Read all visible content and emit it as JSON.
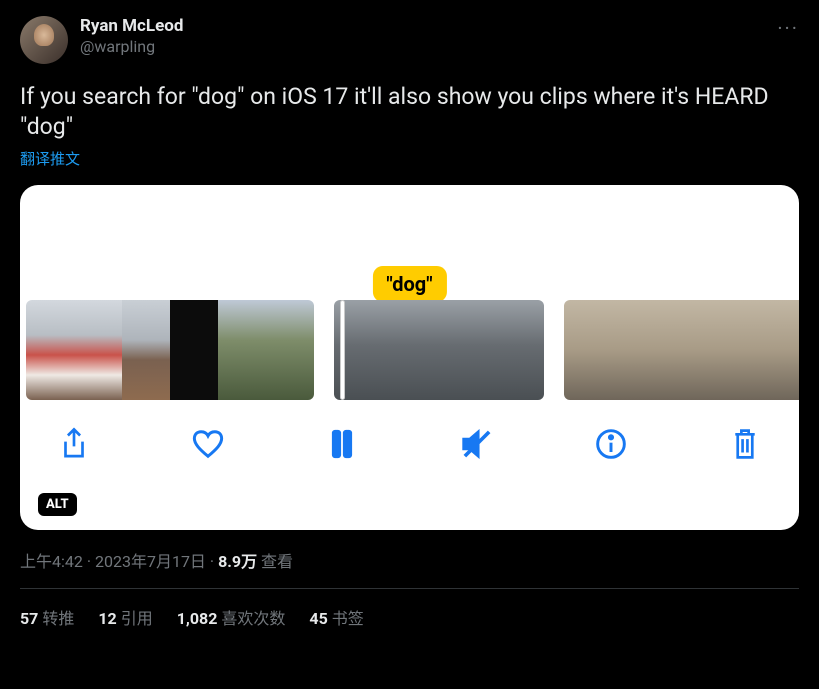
{
  "author": {
    "name": "Ryan McLeod",
    "handle": "@warpling"
  },
  "more_label": "···",
  "text": "If you search for \"dog\" on iOS 17 it'll also show you clips where it's HEARD \"dog\"",
  "translate_label": "翻译推文",
  "search_bubble": "\"dog\"",
  "alt_badge": "ALT",
  "toolbar": {
    "share": "share",
    "like": "like",
    "pause": "pause",
    "mute": "mute",
    "info": "info",
    "delete": "delete"
  },
  "meta": {
    "time": "上午4:42",
    "date": "2023年7月17日",
    "sep": " · ",
    "views_num": "8.9万",
    "views_label": " 查看"
  },
  "stats": {
    "retweets_num": "57",
    "retweets_label": "转推",
    "quotes_num": "12",
    "quotes_label": "引用",
    "likes_num": "1,082",
    "likes_label": "喜欢次数",
    "bookmarks_num": "45",
    "bookmarks_label": "书签"
  }
}
